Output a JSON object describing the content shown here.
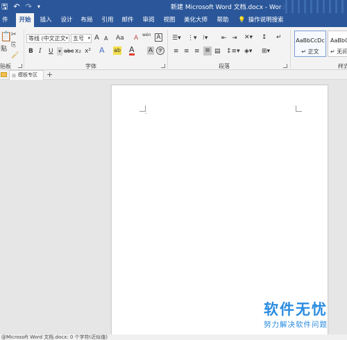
{
  "titlebar": {
    "title": "新建 Microsoft Word 文档.docx - Word",
    "save_icon": "save-icon",
    "undo_icon": "undo-icon",
    "redo_icon": "redo-icon",
    "customize_icon": "chevron-down-icon"
  },
  "tabs": [
    {
      "label": "件",
      "active": false
    },
    {
      "label": "开始",
      "active": true
    },
    {
      "label": "插入",
      "active": false
    },
    {
      "label": "设计",
      "active": false
    },
    {
      "label": "布局",
      "active": false
    },
    {
      "label": "引用",
      "active": false
    },
    {
      "label": "邮件",
      "active": false
    },
    {
      "label": "审阅",
      "active": false
    },
    {
      "label": "视图",
      "active": false
    },
    {
      "label": "美化大师",
      "active": false
    },
    {
      "label": "帮助",
      "active": false
    }
  ],
  "tell_me": {
    "label": "操作说明搜索",
    "icon": "lightbulb-icon"
  },
  "ribbon": {
    "clipboard": {
      "label": "贴板",
      "paste_label": "贴"
    },
    "font": {
      "label": "字体",
      "font_name": "等线 (中文正文",
      "font_size": "五号",
      "grow_label": "A",
      "shrink_label": "A",
      "case_label": "Aa",
      "clear_label": "A",
      "phonetic_label": "wén",
      "border_char_label": "A",
      "bold_label": "B",
      "italic_label": "I",
      "underline_label": "U",
      "strike_label": "abc",
      "sub_label": "x₂",
      "sup_label": "x²",
      "effects_label": "A",
      "highlight_label": "ab",
      "color_label": "A",
      "shade_label": "A",
      "enclose_label": "字",
      "colors": {
        "highlight": "#f4e04d",
        "font_color": "#e03c31"
      }
    },
    "paragraph": {
      "label": "段落"
    },
    "styles": {
      "label": "样式",
      "items": [
        {
          "sample": "AaBbCcDc",
          "name": "↵ 正文",
          "selected": true
        },
        {
          "sample": "AaBbCcD",
          "name": "↵ 无间",
          "selected": false
        }
      ]
    }
  },
  "doc_tabs": {
    "folder_icon": "folder-icon",
    "tab_label": "模板专区",
    "new_tab": "+"
  },
  "status_bar": {
    "text": "@Microsoft Word 文档.docx: 0 个字符(近似值)"
  },
  "watermark": {
    "title": "软件无忧",
    "subtitle": "努力解决软件问题"
  },
  "colors": {
    "accent": "#2b579a",
    "ribbon_bg": "#f3f3f3",
    "canvas_bg": "#e6e6e6",
    "watermark": "#2a8be0"
  }
}
